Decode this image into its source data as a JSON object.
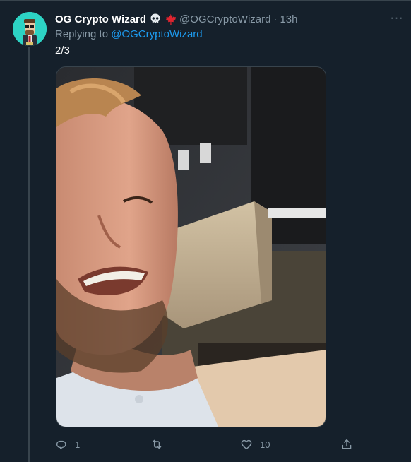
{
  "tweet": {
    "display_name": "OG Crypto Wizard",
    "emojis": [
      "skull-icon",
      "maple-leaf-icon"
    ],
    "handle": "@OGCryptoWizard",
    "separator": "·",
    "time": "13h",
    "more_label": "···",
    "replying_prefix": "Replying to",
    "replying_to": "@OGCryptoWizard",
    "text": "2/3"
  },
  "actions": {
    "reply_count": "1",
    "retweet_count": "",
    "like_count": "10"
  },
  "colors": {
    "background": "#15202b",
    "border": "#38444d",
    "muted_text": "#8899a6",
    "link": "#1d9bf0",
    "avatar_bg": "#2dd3c4",
    "maple_leaf": "#e0242f"
  }
}
